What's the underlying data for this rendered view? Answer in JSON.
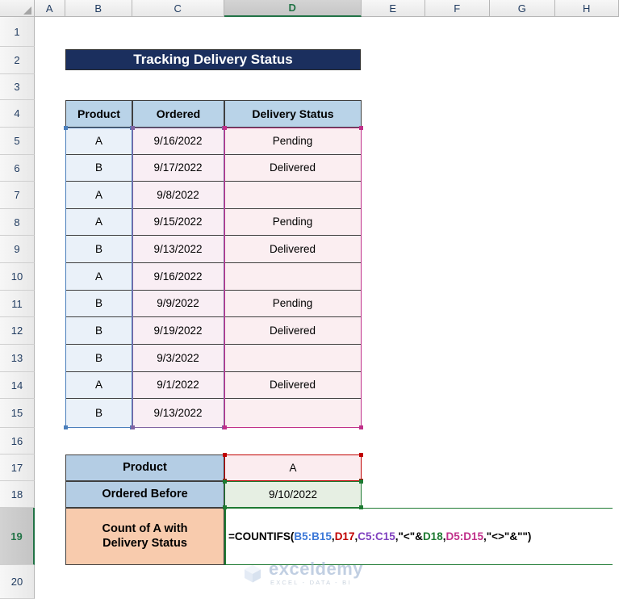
{
  "grid": {
    "columns": [
      "A",
      "B",
      "C",
      "D",
      "E",
      "F",
      "G",
      "H"
    ],
    "active_column": "D",
    "rows": [
      "1",
      "2",
      "3",
      "4",
      "5",
      "6",
      "7",
      "8",
      "9",
      "10",
      "11",
      "12",
      "13",
      "14",
      "15",
      "16",
      "17",
      "18",
      "19",
      "20"
    ],
    "active_row": "19"
  },
  "banner": {
    "title": "Tracking Delivery Status"
  },
  "table": {
    "headers": [
      "Product",
      "Ordered",
      "Delivery Status"
    ],
    "rows": [
      {
        "product": "A",
        "ordered": "9/16/2022",
        "status": "Pending"
      },
      {
        "product": "B",
        "ordered": "9/17/2022",
        "status": "Delivered"
      },
      {
        "product": "A",
        "ordered": "9/8/2022",
        "status": ""
      },
      {
        "product": "A",
        "ordered": "9/15/2022",
        "status": "Pending"
      },
      {
        "product": "B",
        "ordered": "9/13/2022",
        "status": "Delivered"
      },
      {
        "product": "A",
        "ordered": "9/16/2022",
        "status": ""
      },
      {
        "product": "B",
        "ordered": "9/9/2022",
        "status": "Pending"
      },
      {
        "product": "B",
        "ordered": "9/19/2022",
        "status": "Delivered"
      },
      {
        "product": "B",
        "ordered": "9/3/2022",
        "status": ""
      },
      {
        "product": "A",
        "ordered": "9/1/2022",
        "status": "Delivered"
      },
      {
        "product": "B",
        "ordered": "9/13/2022",
        "status": ""
      }
    ]
  },
  "criteria": {
    "product_label": "Product",
    "product_value": "A",
    "ordered_before_label": "Ordered Before",
    "ordered_before_value": "9/10/2022",
    "result_label_line1": "Count of A with",
    "result_label_line2": "Delivery Status",
    "formula": {
      "full": "=COUNTIFS(B5:B15,D17,C5:C15,\"<\"&D18,D5:D15,\"<>\"&\"\")",
      "p1": "=COUNTIFS(",
      "ref1": "B5:B15",
      "sep1": ",",
      "ref2": "D17",
      "sep2": ",",
      "ref3": "C5:C15",
      "sep3": ",\"<\"&",
      "ref4": "D18",
      "sep4": ",",
      "ref5": "D5:D15",
      "tail": ",\"<>\"&\"\")"
    }
  },
  "watermark": {
    "name": "exceldemy",
    "tagline": "EXCEL - DATA - BI"
  },
  "colors": {
    "banner_bg": "#1b2f5e",
    "header_bg": "#b9d3e8",
    "label_blue": "#b4cde4",
    "label_orange": "#f8cbad",
    "sel_blue": "#4a7ebb",
    "sel_purple": "#8064a2",
    "sel_magenta": "#c0308a",
    "sel_red": "#c00000",
    "sel_green": "#1e7a32",
    "active_green": "#217346"
  }
}
